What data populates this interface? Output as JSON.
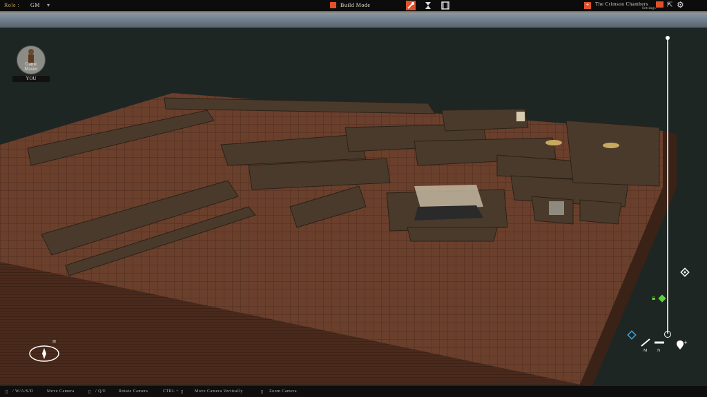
{
  "topbar": {
    "role_label": "Role :",
    "role_value": "GM",
    "mode_label": "Build Mode",
    "session_name": "The Crimson Chambers",
    "settings_label": "Settings"
  },
  "player": {
    "role_line1": "Game",
    "role_line2": "Master",
    "you_label": "YOU"
  },
  "tools": {
    "tool_m": "M",
    "tool_n": "N"
  },
  "controls": [
    {
      "keys": "/ W/A/S/D",
      "action": "Move Camera"
    },
    {
      "keys": "/ Q/E",
      "action": "Rotate Camera"
    },
    {
      "keys": "CTRL +",
      "action": "Move Camera Vertically"
    },
    {
      "keys": "",
      "action": "Zoom Camera"
    }
  ],
  "colors": {
    "accent": "#e0502a",
    "lock_green": "#5fd23a",
    "cursor_blue": "#3aa6e0",
    "floor": "#6a3f2c",
    "wall": "#4a3a2b"
  }
}
